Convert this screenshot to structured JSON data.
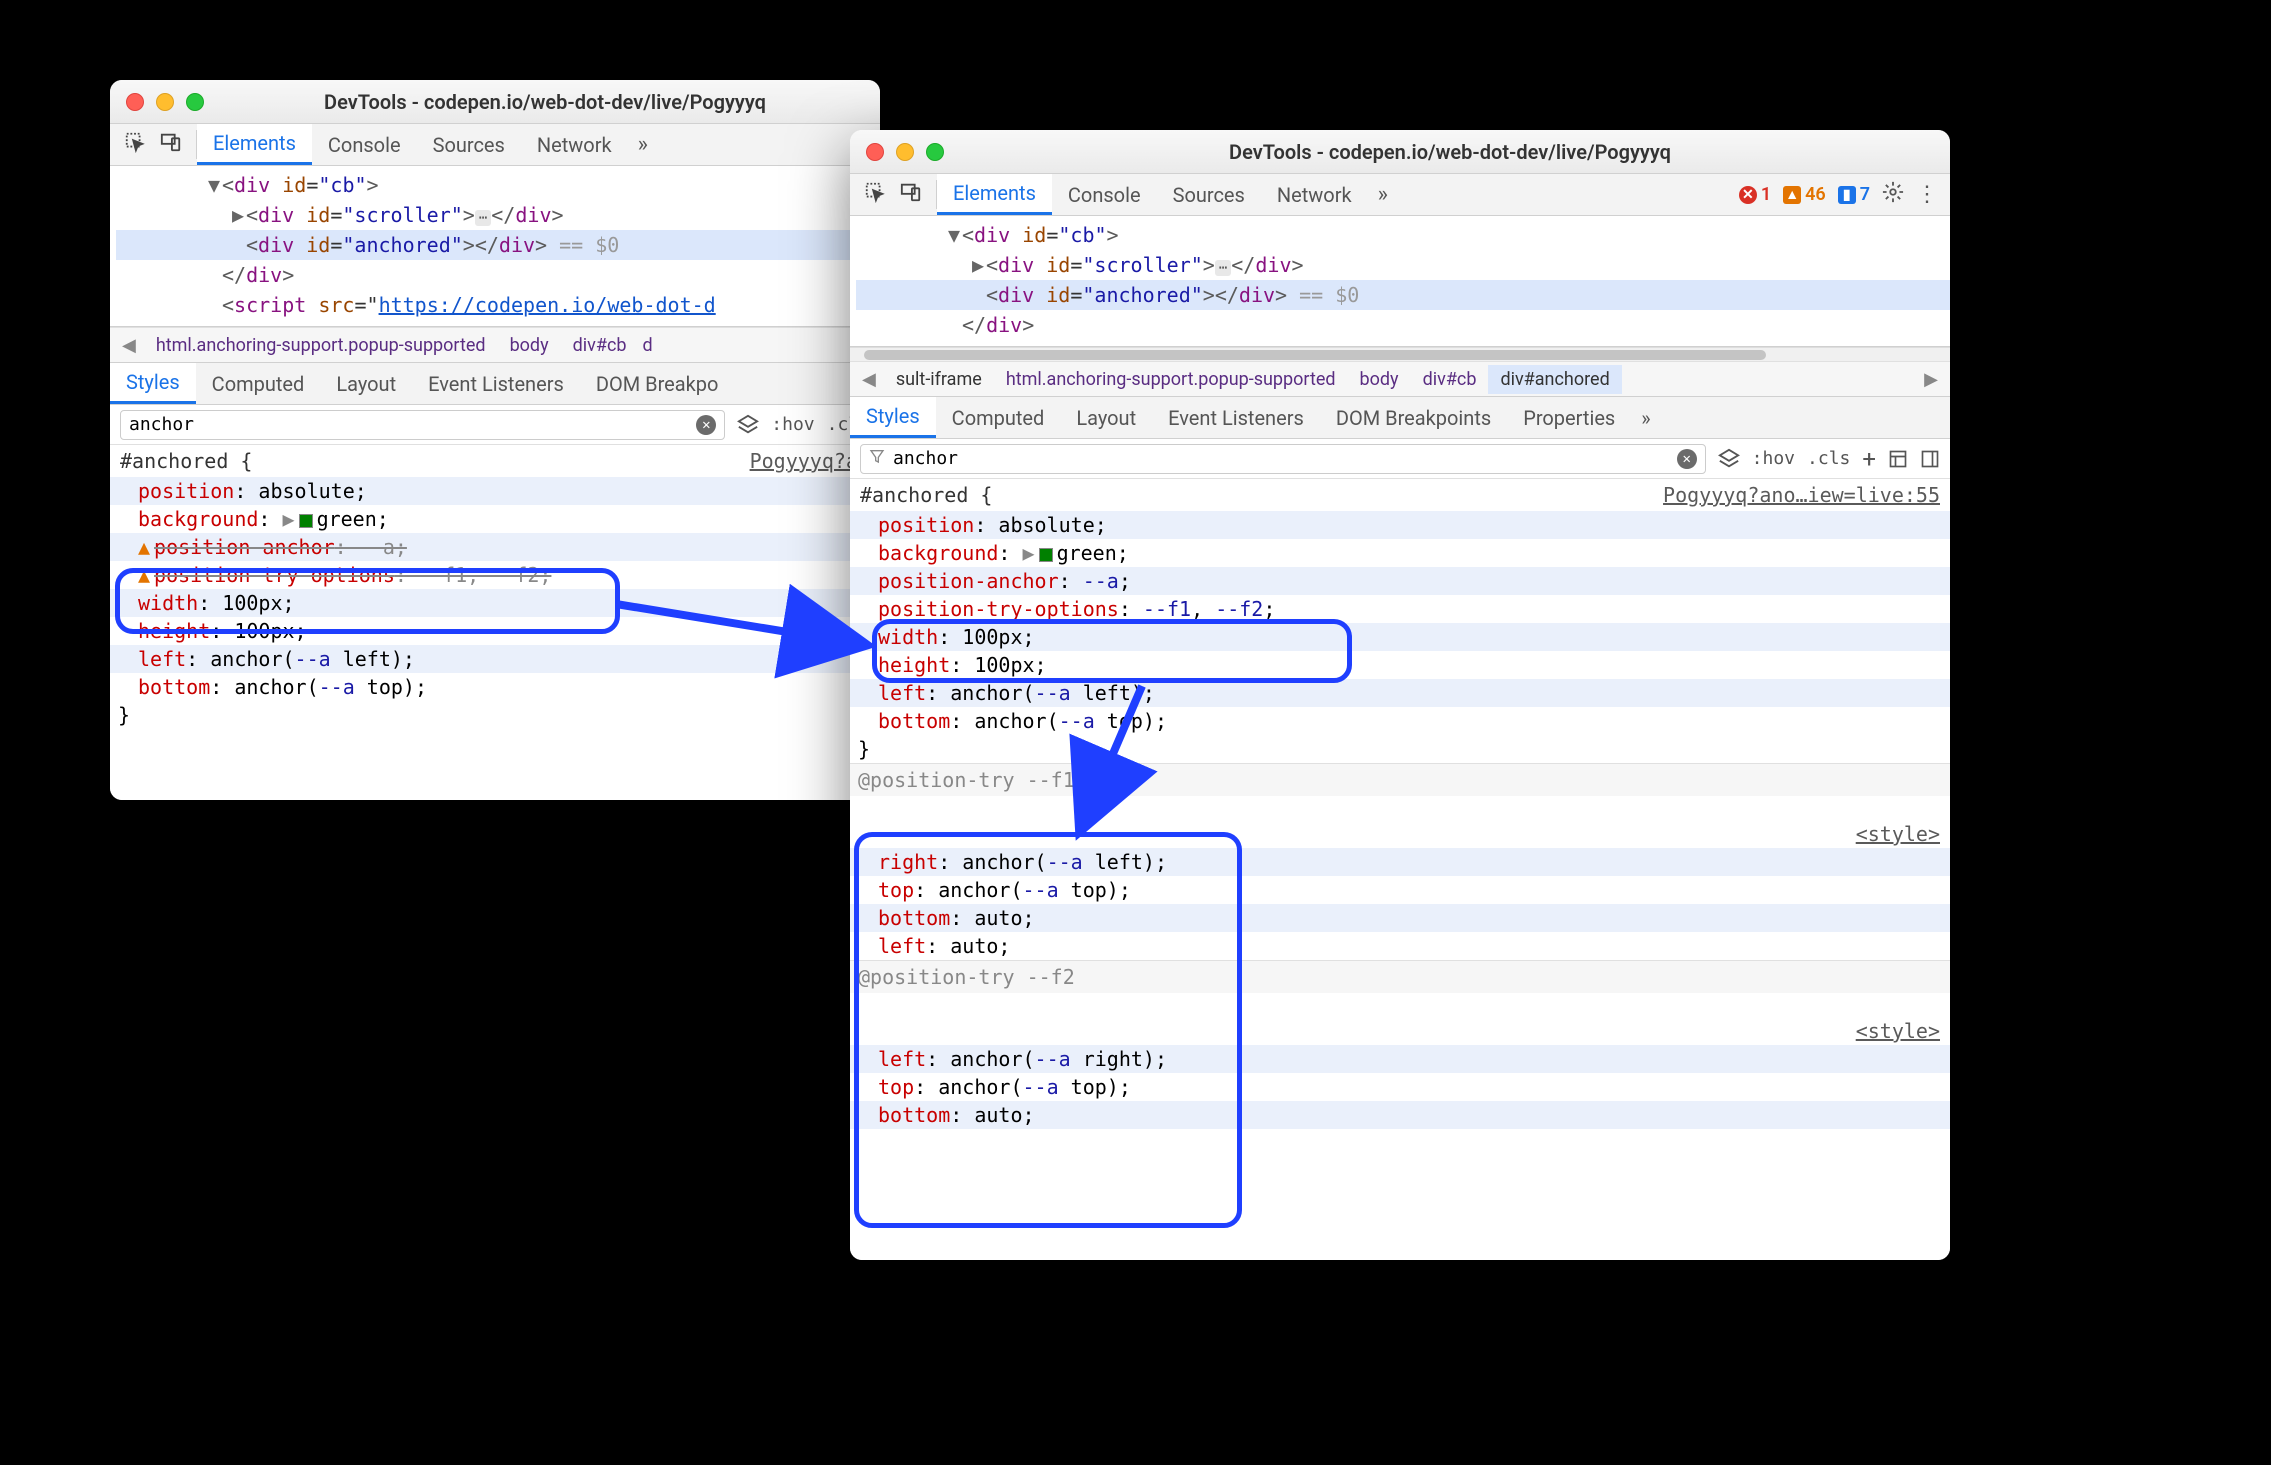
{
  "window_left": {
    "title": "DevTools - codepen.io/web-dot-dev/live/Pogyyyq",
    "tabs": [
      "Elements",
      "Console",
      "Sources",
      "Network"
    ],
    "active_tab_index": 0,
    "dom_lines": [
      {
        "indent": 3,
        "tw": "▼",
        "html": "<span class='txt'>&lt;</span><span class='tag'>div</span> <span class='attrn'>id</span>=<span class='attrv'>\"cb\"</span><span class='txt'>&gt;</span>"
      },
      {
        "indent": 4,
        "tw": "▶",
        "html": "<span class='txt'>&lt;</span><span class='tag'>div</span> <span class='attrn'>id</span>=<span class='attrv'>\"scroller\"</span><span class='txt'>&gt;</span><span class='ellips'>⋯</span><span class='txt'>&lt;/</span><span class='tag'>div</span><span class='txt'>&gt;</span>"
      },
      {
        "indent": 4,
        "sel": true,
        "html": "<span class='txt'>&lt;</span><span class='tag'>div</span> <span class='attrn'>id</span>=<span class='attrv'>\"anchored\"</span><span class='txt'>&gt;&lt;/</span><span class='tag'>div</span><span class='txt'>&gt;</span> <span class='dim'>== $0</span>"
      },
      {
        "indent": 3,
        "html": "<span class='txt'>&lt;/</span><span class='tag'>div</span><span class='txt'>&gt;</span>"
      },
      {
        "indent": 3,
        "html": "<span class='txt'>&lt;</span><span class='tag'>script</span> <span class='attrn'>src</span>=\"<span class='url'>https://codepen.io/web-dot-d</span>"
      }
    ],
    "crumbs": [
      "html.anchoring-support.popup-supported",
      "body",
      "div#cb"
    ],
    "crumb_overflow": "d",
    "panel_tabs": [
      "Styles",
      "Computed",
      "Layout",
      "Event Listeners",
      "DOM Breakpo"
    ],
    "active_panel_index": 0,
    "filter_value": "anchor",
    "source_link": "Pogyyyq?an",
    "selector": "#anchored {",
    "css_lines": [
      {
        "stripe": true,
        "content": "<span class='prop'>position</span>: absolute;"
      },
      {
        "content": "<span class='prop'>background</span>: <span class='disclose'>▶</span><span class='swatch' style='background:#008000'></span>green;"
      },
      {
        "stripe": true,
        "content": "<span class='warn-ico'>▲</span><span class='strike'><span class='prop'>position-anchor</span>: --a;</span>"
      },
      {
        "content": "<span class='warn-ico'>▲</span><span class='strike'><span class='prop'>position-try-options</span>: --f1, --f2;</span>"
      },
      {
        "stripe": true,
        "content": "<span class='prop'>width</span>: 100px;"
      },
      {
        "content": "<span class='prop'>height</span>: 100px;"
      },
      {
        "stripe": true,
        "content": "<span class='prop'>left</span>: anchor(<span class='idv'>--a</span> left);"
      },
      {
        "content": "<span class='prop'>bottom</span>: anchor(<span class='idv'>--a</span> top);"
      }
    ],
    "close": "}"
  },
  "window_right": {
    "title": "DevTools - codepen.io/web-dot-dev/live/Pogyyyq",
    "tabs": [
      "Elements",
      "Console",
      "Sources",
      "Network"
    ],
    "active_tab_index": 0,
    "issues": {
      "errors": 1,
      "warnings": 46,
      "info": 7
    },
    "dom_lines": [
      {
        "indent": 3,
        "tw": "▼",
        "html": "<span class='txt'>&lt;</span><span class='tag'>div</span> <span class='attrn'>id</span>=<span class='attrv'>\"cb\"</span><span class='txt'>&gt;</span>"
      },
      {
        "indent": 4,
        "tw": "▶",
        "html": "<span class='txt'>&lt;</span><span class='tag'>div</span> <span class='attrn'>id</span>=<span class='attrv'>\"scroller\"</span><span class='txt'>&gt;</span><span class='ellips'>⋯</span><span class='txt'>&lt;/</span><span class='tag'>div</span><span class='txt'>&gt;</span>"
      },
      {
        "indent": 4,
        "sel": true,
        "html": "<span class='txt'>&lt;</span><span class='tag'>div</span> <span class='attrn'>id</span>=<span class='attrv'>\"anchored\"</span><span class='txt'>&gt;&lt;/</span><span class='tag'>div</span><span class='txt'>&gt;</span> <span class='dim'>== $0</span>"
      },
      {
        "indent": 3,
        "html": "<span class='txt'>&lt;/</span><span class='tag'>div</span><span class='txt'>&gt;</span>"
      }
    ],
    "crumbs_pre": "sult-iframe",
    "crumbs": [
      "html.anchoring-support.popup-supported",
      "body",
      "div#cb",
      "div#anchored"
    ],
    "crumb_selected_index": 3,
    "panel_tabs": [
      "Styles",
      "Computed",
      "Layout",
      "Event Listeners",
      "DOM Breakpoints",
      "Properties"
    ],
    "active_panel_index": 0,
    "filter_value": "anchor",
    "source_link": "Pogyyyq?ano…iew=live:55",
    "selector": "#anchored {",
    "css_lines": [
      {
        "stripe": true,
        "content": "<span class='prop'>position</span>: absolute;"
      },
      {
        "content": "<span class='prop'>background</span>: <span class='disclose'>▶</span><span class='swatch' style='background:#008000'></span>green;"
      },
      {
        "stripe": true,
        "content": "<span class='prop'>position-anchor</span>: <span class='idv'>--a</span>;"
      },
      {
        "content": "<span class='prop'>position-try-options</span>: <span class='idv'>--f1</span>, <span class='idv'>--f2</span>;"
      },
      {
        "stripe": true,
        "content": "<span class='prop'>width</span>: 100px;"
      },
      {
        "content": "<span class='prop'>height</span>: 100px;"
      },
      {
        "stripe": true,
        "content": "<span class='prop'>left</span>: anchor(<span class='idv'>--a</span> left);"
      },
      {
        "content": "<span class='prop'>bottom</span>: anchor(<span class='idv'>--a</span> top);"
      }
    ],
    "close": "}",
    "atrules": [
      {
        "header": "@position-try --f1",
        "style_link": "<style>",
        "lines": [
          {
            "stripe": true,
            "content": "<span class='prop'>right</span>: anchor(<span class='idv'>--a</span> left);"
          },
          {
            "content": "<span class='prop'>top</span>: anchor(<span class='idv'>--a</span> top);"
          },
          {
            "stripe": true,
            "content": "<span class='prop'>bottom</span>: auto;"
          },
          {
            "content": "<span class='prop'>left</span>: auto;"
          }
        ]
      },
      {
        "header": "@position-try --f2",
        "style_link": "<style>",
        "lines": [
          {
            "stripe": true,
            "content": "<span class='prop'>left</span>: anchor(<span class='idv'>--a</span> right);"
          },
          {
            "content": "<span class='prop'>top</span>: anchor(<span class='idv'>--a</span> top);"
          },
          {
            "stripe": true,
            "content": "<span class='prop'>bottom</span>: auto;"
          }
        ]
      }
    ]
  },
  "toolbar_labels": {
    "hov": ":hov",
    "cls": ".cls"
  }
}
